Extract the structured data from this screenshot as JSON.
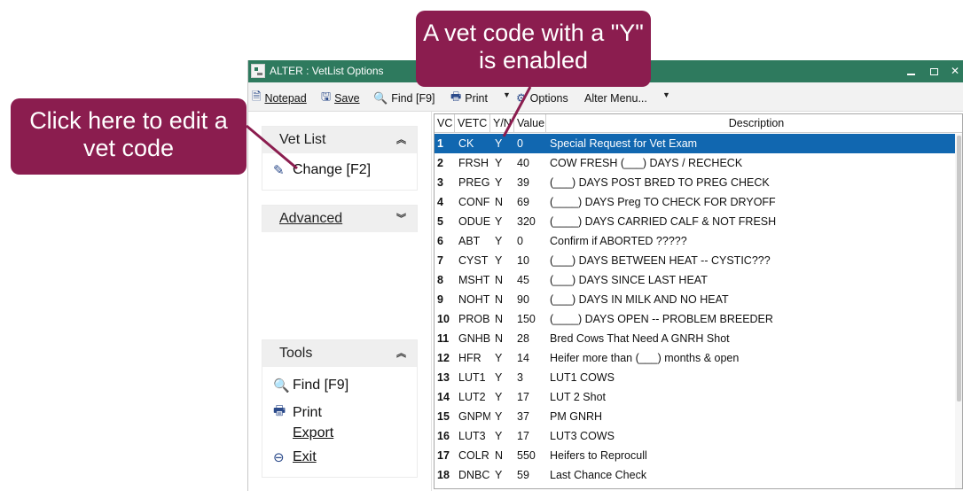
{
  "window": {
    "title": "ALTER : VetList Options"
  },
  "toolbar": {
    "notepad": "Notepad",
    "save": "Save",
    "find": "Find [F9]",
    "print": "Print",
    "options": "Options",
    "alter_menu": "Alter Menu..."
  },
  "left_panel": {
    "vet_list": {
      "title": "Vet List",
      "items": [
        "Change [F2]"
      ]
    },
    "advanced": {
      "title": "Advanced"
    },
    "tools": {
      "title": "Tools",
      "items": [
        "Find [F9]",
        "Print",
        "Export",
        "Exit"
      ]
    }
  },
  "grid": {
    "columns": [
      "VC",
      "VETC",
      "Y/N",
      "Value",
      "Description"
    ],
    "selected_row": 0,
    "rows": [
      [
        "1",
        "CK",
        "Y",
        "0",
        "Special Request for Vet Exam"
      ],
      [
        "2",
        "FRSH",
        "Y",
        "40",
        "COW FRESH (___) DAYS / RECHECK"
      ],
      [
        "3",
        "PREG",
        "Y",
        "39",
        "(___) DAYS POST BRED TO PREG CHECK"
      ],
      [
        "4",
        "CONF",
        "N",
        "69",
        "(____) DAYS Preg TO CHECK FOR DRYOFF"
      ],
      [
        "5",
        "ODUE",
        "Y",
        "320",
        "(____) DAYS CARRIED CALF & NOT FRESH"
      ],
      [
        "6",
        "ABT",
        "Y",
        "0",
        "Confirm if ABORTED ?????"
      ],
      [
        "7",
        "CYST",
        "Y",
        "10",
        "(___) DAYS BETWEEN HEAT -- CYSTIC???"
      ],
      [
        "8",
        "MSHT",
        "N",
        "45",
        "(___) DAYS SINCE LAST HEAT"
      ],
      [
        "9",
        "NOHT",
        "N",
        "90",
        "(___) DAYS IN MILK AND NO HEAT"
      ],
      [
        "10",
        "PROB",
        "N",
        "150",
        "(____) DAYS OPEN -- PROBLEM BREEDER"
      ],
      [
        "11",
        "GNHB",
        "N",
        "28",
        "Bred Cows That Need A GNRH Shot"
      ],
      [
        "12",
        "HFR",
        "Y",
        "14",
        "Heifer more than (___) months & open"
      ],
      [
        "13",
        "LUT1",
        "Y",
        "3",
        "LUT1 COWS"
      ],
      [
        "14",
        "LUT2",
        "Y",
        "17",
        "LUT 2 Shot"
      ],
      [
        "15",
        "GNPM",
        "Y",
        "37",
        "PM GNRH"
      ],
      [
        "16",
        "LUT3",
        "Y",
        "17",
        "LUT3 COWS"
      ],
      [
        "17",
        "COLR",
        "N",
        "550",
        "Heifers to Reprocull"
      ],
      [
        "18",
        "DNBC",
        "Y",
        "59",
        "Last Chance Check"
      ]
    ]
  },
  "callouts": {
    "edit": "Click here to edit a vet code",
    "vet": "A vet code with a \"Y\" is enabled"
  },
  "colors": {
    "titlebar": "#2e7a5e",
    "selection": "#1167b0",
    "callout": "#8b1d4f"
  },
  "icons": [
    "app-logo-icon",
    "notepad-icon",
    "save-icon",
    "find-icon",
    "print-icon",
    "options-gear-icon",
    "change-pencil-icon",
    "search-icon",
    "printer-icon",
    "exit-icon",
    "chevron-up-icon",
    "chevron-down-icon"
  ]
}
